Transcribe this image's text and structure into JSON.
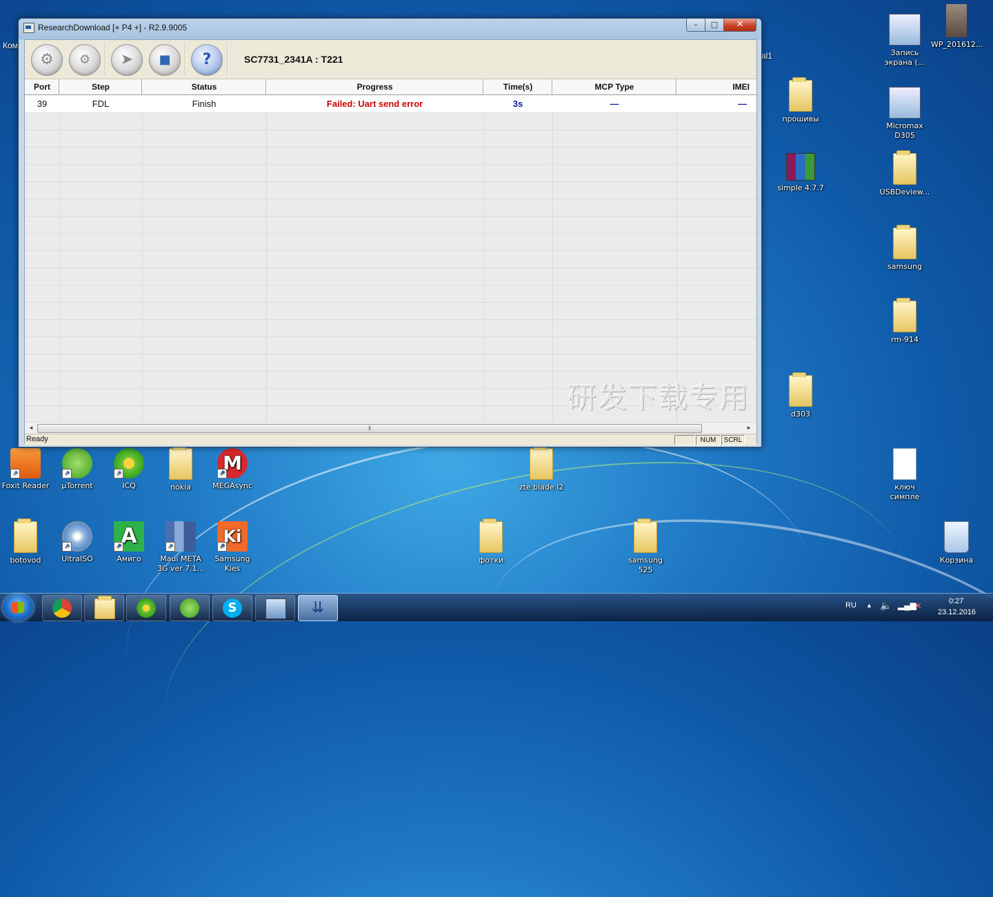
{
  "window": {
    "title": "ResearchDownload [+ P4 +] - R2.9.9005",
    "min": "–",
    "max": "□",
    "close": "✕"
  },
  "toolbar": {
    "buttons": [
      {
        "name": "load-packet-button",
        "glyph": "⚙"
      },
      {
        "name": "settings-button",
        "glyph": "⚙"
      },
      {
        "name": "start-download-button",
        "glyph": "➤"
      },
      {
        "name": "stop-download-button",
        "glyph": "■"
      },
      {
        "name": "help-button",
        "glyph": "?"
      }
    ],
    "device": "SC7731_2341A : T221"
  },
  "grid": {
    "columns": [
      "Port",
      "Step",
      "Status",
      "Progress",
      "Time(s)",
      "MCP Type",
      "IMEI"
    ],
    "rows": [
      {
        "port": "39",
        "step": "FDL",
        "status": "Finish",
        "progress": "Failed: Uart send error",
        "time": "3s",
        "mcp": "—",
        "imei": "—"
      }
    ],
    "watermark": "研发下载专用"
  },
  "statusbar": {
    "text": "Ready",
    "num": "NUM",
    "scrl": "SCRL"
  },
  "desktop": {
    "icons": [
      {
        "label": "Запись экрана (..."
      },
      {
        "label": "WP_201612..."
      },
      {
        "label": "прошивы"
      },
      {
        "label": "Micromax D305"
      },
      {
        "label": "simple 4.7.7"
      },
      {
        "label": "USBDeview..."
      },
      {
        "label": "samsung"
      },
      {
        "label": "rm-914"
      },
      {
        "label": "d303"
      },
      {
        "label": "Foxit Reader"
      },
      {
        "label": "µTorrent"
      },
      {
        "label": "ICQ"
      },
      {
        "label": "nokia"
      },
      {
        "label": "MEGAsync"
      },
      {
        "label": "zte blade l2"
      },
      {
        "label": "ключ симпле"
      },
      {
        "label": "botovod"
      },
      {
        "label": "UltraISO"
      },
      {
        "label": "Амиго"
      },
      {
        "label": "Maui META 3G ver 7.1..."
      },
      {
        "label": "Samsung Kies"
      },
      {
        "label": "фотки"
      },
      {
        "label": "samsung 525"
      },
      {
        "label": "Корзина"
      }
    ],
    "partial_labels": {
      "left_top": "Ком",
      "mid_right": "al1"
    }
  },
  "taskbar": {
    "lang": "RU",
    "time": "0:27",
    "date": "23.12.2016"
  }
}
